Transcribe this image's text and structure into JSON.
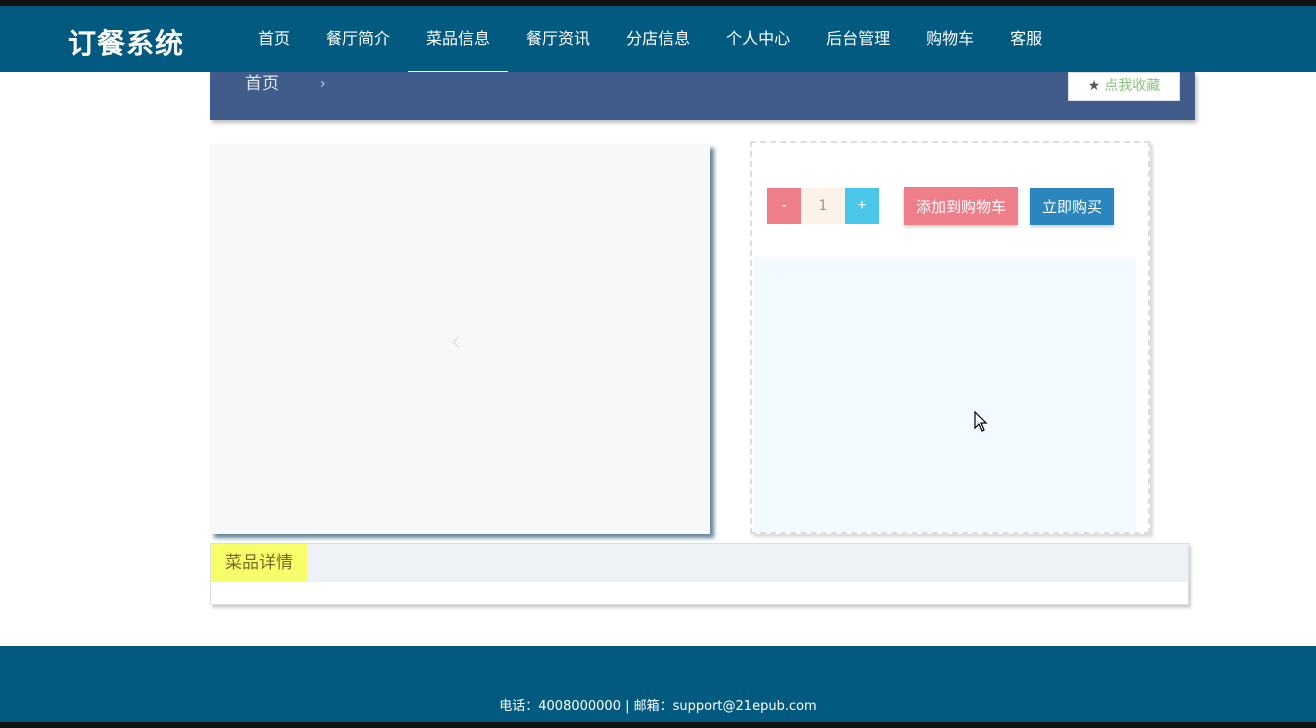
{
  "header": {
    "logo": "订餐系统",
    "nav": [
      {
        "label": "首页"
      },
      {
        "label": "餐厅简介"
      },
      {
        "label": "菜品信息",
        "active": true
      },
      {
        "label": "餐厅资讯"
      },
      {
        "label": "分店信息"
      },
      {
        "label": "个人中心"
      },
      {
        "label": "后台管理"
      },
      {
        "label": "购物车"
      },
      {
        "label": "客服"
      }
    ]
  },
  "breadcrumb": {
    "home": "首页",
    "separator": "›",
    "favorite_label": "点我收藏",
    "favorite_icon": "star-icon"
  },
  "product": {
    "quantity": {
      "minus_label": "-",
      "value": "1",
      "plus_label": "+"
    },
    "add_to_cart_label": "添加到购物车",
    "buy_now_label": "立即购买"
  },
  "detail": {
    "tab_label": "菜品详情"
  },
  "footer": {
    "text": "电话：4008000000 | 邮箱：support@21epub.com"
  },
  "colors": {
    "navbar": "#035a80",
    "breadcrumb": "#3f5c8a",
    "cart_button": "#ee7f8a",
    "buy_button": "#2a86bd",
    "plus_button": "#4ac6ea",
    "detail_tab": "#f6ff6a"
  }
}
